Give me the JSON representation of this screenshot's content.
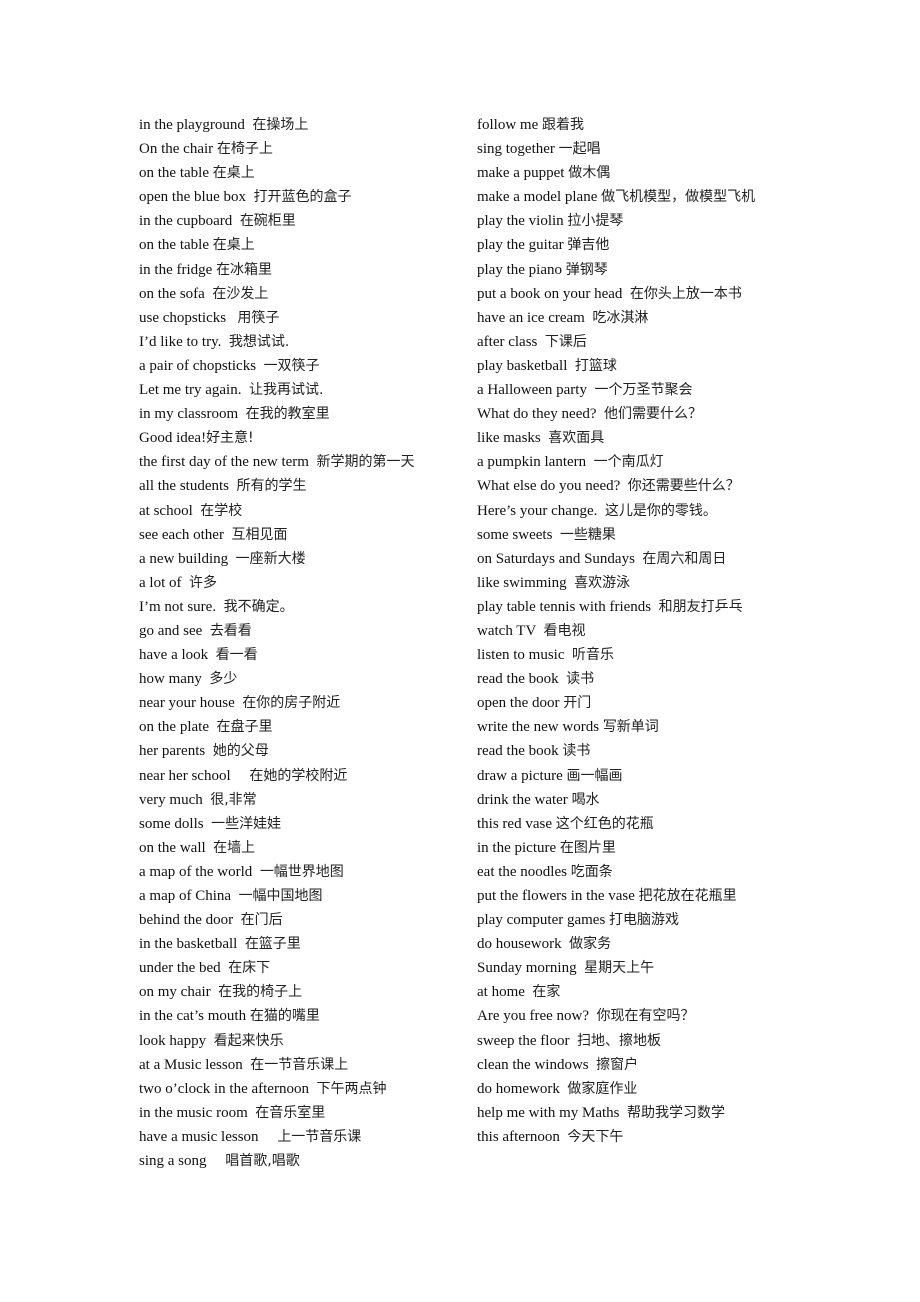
{
  "document": {
    "left_column": [
      {
        "en": "in the playground",
        "sep": "  ",
        "zh": "在操场上"
      },
      {
        "en": "On the chair",
        "sep": " ",
        "zh": "在椅子上"
      },
      {
        "en": "on the table",
        "sep": " ",
        "zh": "在桌上"
      },
      {
        "en": "open the blue box",
        "sep": "  ",
        "zh": "打开蓝色的盒子"
      },
      {
        "en": "in the cupboard",
        "sep": "  ",
        "zh": "在碗柜里"
      },
      {
        "en": "on the table",
        "sep": " ",
        "zh": "在桌上"
      },
      {
        "en": "in the fridge",
        "sep": " ",
        "zh": "在冰箱里"
      },
      {
        "en": "on the sofa",
        "sep": "  ",
        "zh": "在沙发上"
      },
      {
        "en": "use chopsticks",
        "sep": "   ",
        "zh": "用筷子"
      },
      {
        "en": "I’d like to try.",
        "sep": "  ",
        "zh": "我想试试."
      },
      {
        "en": "a pair of chopsticks",
        "sep": "  ",
        "zh": "一双筷子"
      },
      {
        "en": "Let me try again.",
        "sep": "  ",
        "zh": "让我再试试."
      },
      {
        "en": "in my classroom",
        "sep": "  ",
        "zh": "在我的教室里"
      },
      {
        "en": "Good idea!",
        "sep": "",
        "zh": "好主意!"
      },
      {
        "en": "the first day of the new term",
        "sep": "  ",
        "zh": "新学期的第一天"
      },
      {
        "en": "all the students",
        "sep": "  ",
        "zh": "所有的学生"
      },
      {
        "en": "at school",
        "sep": "  ",
        "zh": "在学校"
      },
      {
        "en": "see each other",
        "sep": "  ",
        "zh": "互相见面"
      },
      {
        "en": "a new building",
        "sep": "  ",
        "zh": "一座新大楼"
      },
      {
        "en": "a lot of",
        "sep": "  ",
        "zh": "许多"
      },
      {
        "en": "I’m not sure.",
        "sep": "  ",
        "zh": "我不确定。"
      },
      {
        "en": "go and see",
        "sep": "  ",
        "zh": "去看看"
      },
      {
        "en": "have a look",
        "sep": "  ",
        "zh": "看一看"
      },
      {
        "en": "how many",
        "sep": "  ",
        "zh": "多少"
      },
      {
        "en": "near your house",
        "sep": "  ",
        "zh": "在你的房子附近"
      },
      {
        "en": "on the plate",
        "sep": "  ",
        "zh": "在盘子里"
      },
      {
        "en": "her parents",
        "sep": "  ",
        "zh": "她的父母"
      },
      {
        "en": "near her school",
        "sep": "     ",
        "zh": "在她的学校附近"
      },
      {
        "en": "very much",
        "sep": "  ",
        "zh": "很,非常"
      },
      {
        "en": "some dolls",
        "sep": "  ",
        "zh": "一些洋娃娃"
      },
      {
        "en": "on the wall",
        "sep": "  ",
        "zh": "在墙上"
      },
      {
        "en": "a map of the world",
        "sep": "  ",
        "zh": "一幅世界地图"
      },
      {
        "en": "a map of China",
        "sep": "  ",
        "zh": "一幅中国地图"
      },
      {
        "en": "behind the door",
        "sep": "  ",
        "zh": "在门后"
      },
      {
        "en": "in the basketball",
        "sep": "  ",
        "zh": "在篮子里"
      },
      {
        "en": "under the bed",
        "sep": "  ",
        "zh": "在床下"
      },
      {
        "en": "on my chair",
        "sep": "  ",
        "zh": "在我的椅子上"
      },
      {
        "en": "in the cat’s mouth",
        "sep": " ",
        "zh": "在猫的嘴里"
      },
      {
        "en": "look happy",
        "sep": "  ",
        "zh": "看起来快乐"
      },
      {
        "en": "at a Music lesson",
        "sep": "  ",
        "zh": "在一节音乐课上"
      },
      {
        "en": "two o’clock in the afternoon",
        "sep": "  ",
        "zh": "下午两点钟"
      },
      {
        "en": "in the music room",
        "sep": "  ",
        "zh": "在音乐室里"
      },
      {
        "en": "have a music lesson",
        "sep": "     ",
        "zh": "上一节音乐课"
      },
      {
        "en": "sing a song",
        "sep": "     ",
        "zh": "唱首歌,唱歌"
      }
    ],
    "right_column": [
      {
        "en": "follow me",
        "sep": " ",
        "zh": "跟着我"
      },
      {
        "en": "sing together",
        "sep": " ",
        "zh": "一起唱"
      },
      {
        "en": "make a puppet",
        "sep": " ",
        "zh": "做木偶"
      },
      {
        "en": "make a model plane",
        "sep": " ",
        "zh": "做飞机模型，做模型飞机"
      },
      {
        "en": "play the violin",
        "sep": " ",
        "zh": "拉小提琴"
      },
      {
        "en": "play the guitar",
        "sep": " ",
        "zh": "弹吉他"
      },
      {
        "en": "play the piano",
        "sep": " ",
        "zh": "弹钢琴"
      },
      {
        "en": "put a book on your head",
        "sep": "  ",
        "zh": "在你头上放一本书"
      },
      {
        "en": "have an ice cream",
        "sep": "  ",
        "zh": "吃冰淇淋"
      },
      {
        "en": "after class",
        "sep": "  ",
        "zh": "下课后"
      },
      {
        "en": "play basketball",
        "sep": "  ",
        "zh": "打篮球"
      },
      {
        "en": "a Halloween party",
        "sep": "  ",
        "zh": "一个万圣节聚会"
      },
      {
        "en": "What do they need?",
        "sep": "  ",
        "zh": "他们需要什么？"
      },
      {
        "en": "like masks",
        "sep": "  ",
        "zh": "喜欢面具"
      },
      {
        "en": "a pumpkin lantern",
        "sep": "  ",
        "zh": "一个南瓜灯"
      },
      {
        "en": "What else do you need?",
        "sep": "  ",
        "zh": "你还需要些什么？"
      },
      {
        "en": "Here’s your change.",
        "sep": "  ",
        "zh": "这儿是你的零钱。"
      },
      {
        "en": "some sweets",
        "sep": "  ",
        "zh": "一些糖果"
      },
      {
        "en": "on Saturdays and Sundays",
        "sep": "  ",
        "zh": "在周六和周日"
      },
      {
        "en": "like swimming",
        "sep": "  ",
        "zh": "喜欢游泳"
      },
      {
        "en": "play table tennis with friends",
        "sep": "  ",
        "zh": "和朋友打乒乓"
      },
      {
        "en": "watch TV",
        "sep": "  ",
        "zh": "看电视"
      },
      {
        "en": "listen to music",
        "sep": "  ",
        "zh": "听音乐"
      },
      {
        "en": "read the book",
        "sep": "  ",
        "zh": "读书"
      },
      {
        "en": "open the door",
        "sep": " ",
        "zh": "开门"
      },
      {
        "en": "write the new words",
        "sep": " ",
        "zh": "写新单词"
      },
      {
        "en": "read the book",
        "sep": " ",
        "zh": "读书"
      },
      {
        "en": "draw a picture",
        "sep": " ",
        "zh": "画一幅画"
      },
      {
        "en": "drink the water",
        "sep": " ",
        "zh": "喝水"
      },
      {
        "en": "this red vase",
        "sep": " ",
        "zh": "这个红色的花瓶"
      },
      {
        "en": "in the picture",
        "sep": " ",
        "zh": "在图片里"
      },
      {
        "en": "eat the noodles",
        "sep": " ",
        "zh": "吃面条"
      },
      {
        "en": "put the flowers in the vase",
        "sep": " ",
        "zh": "把花放在花瓶里"
      },
      {
        "en": "play computer games",
        "sep": " ",
        "zh": "打电脑游戏"
      },
      {
        "en": "do housework",
        "sep": "  ",
        "zh": "做家务"
      },
      {
        "en": "Sunday morning",
        "sep": "  ",
        "zh": "星期天上午"
      },
      {
        "en": "at home",
        "sep": "  ",
        "zh": "在家"
      },
      {
        "en": "Are you free now?",
        "sep": "  ",
        "zh": "你现在有空吗？"
      },
      {
        "en": "sweep the floor",
        "sep": "  ",
        "zh": "扫地、擦地板"
      },
      {
        "en": "clean the windows",
        "sep": "  ",
        "zh": "擦窗户"
      },
      {
        "en": "do homework",
        "sep": "  ",
        "zh": "做家庭作业"
      },
      {
        "en": "help me with my Maths",
        "sep": "  ",
        "zh": "帮助我学习数学"
      },
      {
        "en": "this afternoon",
        "sep": "  ",
        "zh": "今天下午"
      }
    ]
  }
}
